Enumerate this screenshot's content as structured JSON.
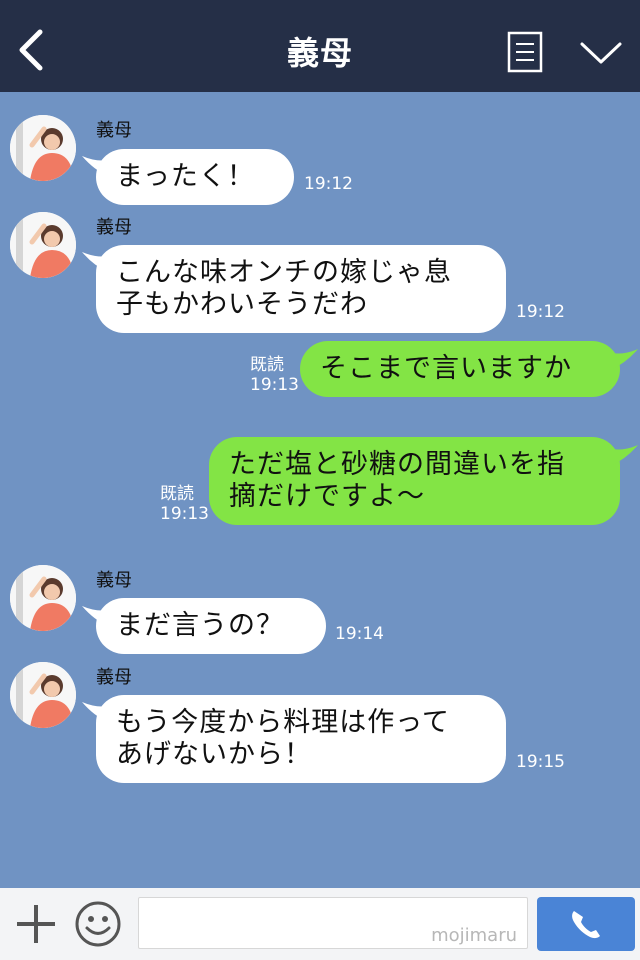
{
  "header": {
    "title": "義母",
    "back_icon": "chevron-left-icon",
    "menu_icon": "document-list-icon",
    "expand_icon": "chevron-down-icon"
  },
  "messages": [
    {
      "side": "in",
      "sender": "義母",
      "lines": [
        "まったく！"
      ],
      "time": "19:12"
    },
    {
      "side": "in",
      "sender": "義母",
      "lines": [
        "こんな味オンチの嫁じゃ息",
        "子もかわいそうだわ"
      ],
      "time": "19:12"
    },
    {
      "side": "out",
      "read": "既読",
      "lines": [
        "そこまで言いますか"
      ],
      "time": "19:13"
    },
    {
      "side": "out",
      "read": "既読",
      "lines": [
        "ただ塩と砂糖の間違いを指",
        "摘だけですよ〜"
      ],
      "time": "19:13"
    },
    {
      "side": "in",
      "sender": "義母",
      "lines": [
        "まだ言うの？"
      ],
      "time": "19:14"
    },
    {
      "side": "in",
      "sender": "義母",
      "lines": [
        "もう今度から料理は作って",
        "あげないから！"
      ],
      "time": "19:15"
    }
  ],
  "footer": {
    "input_value": "",
    "watermark": "mojimaru",
    "plus_icon": "plus-icon",
    "emoji_icon": "smiley-icon",
    "call_icon": "phone-icon"
  },
  "colors": {
    "header": "#252f47",
    "background": "#7093c3",
    "incoming": "#ffffff",
    "outgoing": "#83e445",
    "call_button": "#4a84d6"
  }
}
